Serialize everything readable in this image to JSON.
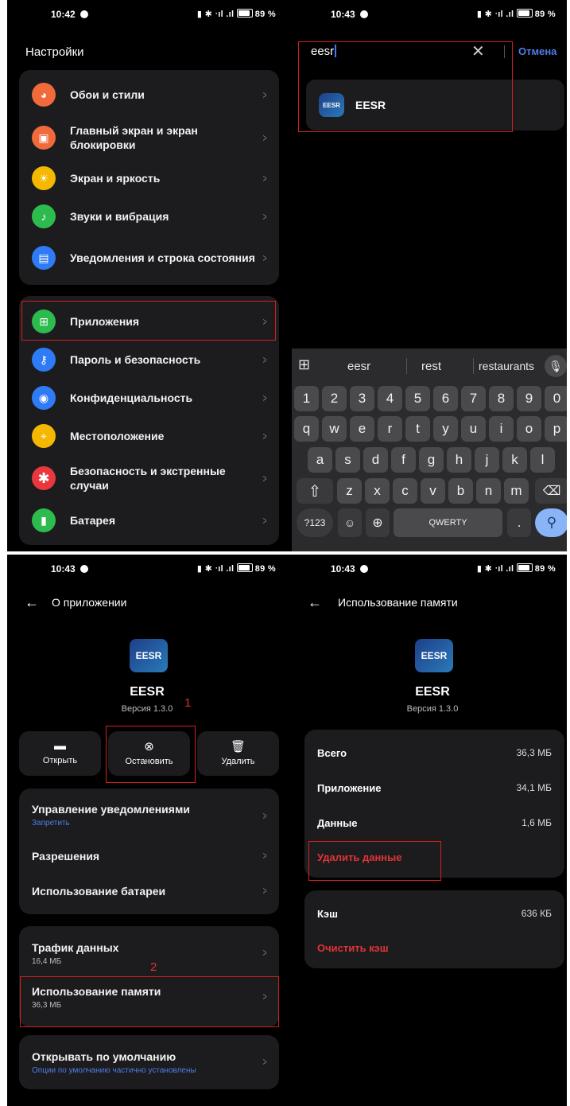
{
  "status": {
    "time1": "10:42",
    "time2": "10:43",
    "time3": "10:43",
    "time4": "10:43",
    "indicators": "‡ ✱ ʸᴸᵇᶛᵘ .ııl",
    "battery": "89 %"
  },
  "settings": {
    "title": "Настройки",
    "group1": [
      {
        "label": "Обои и стили",
        "icon": "palette-icon",
        "color": "#f06a3c"
      },
      {
        "label": "Главный экран и экран блокировки",
        "icon": "image-icon",
        "color": "#f06a3c"
      },
      {
        "label": "Экран и яркость",
        "icon": "sun-icon",
        "color": "#f5b800"
      },
      {
        "label": "Звуки и вибрация",
        "icon": "bell-icon",
        "color": "#2dbb4e"
      },
      {
        "label": "Уведомления и строка состояния",
        "icon": "notification-icon",
        "color": "#2f7bf5"
      }
    ],
    "group2": [
      {
        "label": "Приложения",
        "icon": "apps-icon",
        "color": "#2dbb4e"
      },
      {
        "label": "Пароль и безопасность",
        "icon": "key-icon",
        "color": "#2f7bf5"
      },
      {
        "label": "Конфиденциальность",
        "icon": "eye-icon",
        "color": "#2f7bf5"
      },
      {
        "label": "Местоположение",
        "icon": "location-icon",
        "color": "#f5b800"
      },
      {
        "label": "Безопасность и экстренные случаи",
        "icon": "asterisk-icon",
        "color": "#e8383d"
      },
      {
        "label": "Батарея",
        "icon": "battery-icon",
        "color": "#2dbb4e"
      }
    ]
  },
  "search": {
    "query": "eesr",
    "cancel": "Отмена",
    "result_name": "EESR",
    "result_icon_text": "EESR"
  },
  "keyboard": {
    "suggestions": [
      "eesr",
      "rest",
      "restaurants"
    ],
    "row_numbers": [
      "1",
      "2",
      "3",
      "4",
      "5",
      "6",
      "7",
      "8",
      "9",
      "0"
    ],
    "row1": [
      "q",
      "w",
      "e",
      "r",
      "t",
      "y",
      "u",
      "i",
      "o",
      "p"
    ],
    "row2": [
      "a",
      "s",
      "d",
      "f",
      "g",
      "h",
      "j",
      "k",
      "l"
    ],
    "row3": [
      "z",
      "x",
      "c",
      "v",
      "b",
      "n",
      "m"
    ],
    "symbols_label": "?123",
    "space_label": "QWERTY",
    "period": "."
  },
  "app_info": {
    "header": "О приложении",
    "app_name": "EESR",
    "version": "Версия 1.3.0",
    "icon_text": "EESR",
    "step1": "1",
    "step2": "2",
    "actions": {
      "open": "Открыть",
      "stop": "Остановить",
      "delete": "Удалить"
    },
    "notifications": "Управление уведомлениями",
    "notifications_sub": "Запретить",
    "permissions": "Разрешения",
    "battery_usage": "Использование батареи",
    "data_traffic": "Трафик данных",
    "data_traffic_sub": "16,4 МБ",
    "storage_usage": "Использование памяти",
    "storage_usage_sub": "36,3 МБ",
    "open_default": "Открывать по умолчанию",
    "open_default_sub": "Опции по умолчанию частично установлены"
  },
  "storage": {
    "header": "Использование памяти",
    "app_name": "EESR",
    "version": "Версия 1.3.0",
    "icon_text": "EESR",
    "total_label": "Всего",
    "total_value": "36,3 МБ",
    "app_label": "Приложение",
    "app_value": "34,1 МБ",
    "data_label": "Данные",
    "data_value": "1,6 МБ",
    "clear_data": "Удалить данные",
    "cache_label": "Кэш",
    "cache_value": "636 КБ",
    "clear_cache": "Очистить кэш"
  },
  "colors": {
    "accent_blue": "#4f7ee8",
    "highlight_red": "#d32020"
  }
}
